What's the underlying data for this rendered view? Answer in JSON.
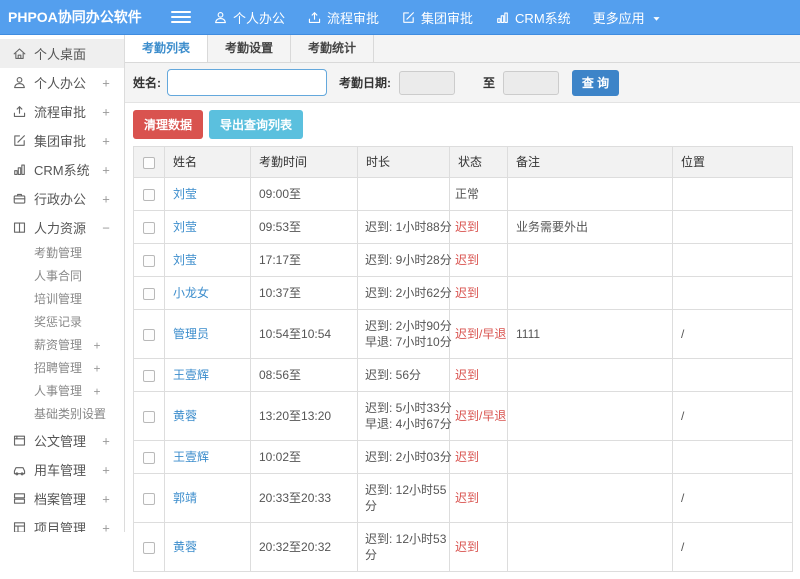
{
  "colors": {
    "header_bg": "#549fee",
    "header_border": "#3f8ce0",
    "accent_blue": "#3c8dcc",
    "button_primary": "#3d84c8",
    "button_danger": "#d9534f",
    "button_info": "#5bc0de",
    "status_alert": "#d9534f"
  },
  "header": {
    "logo": "PHPOA协同办公软件",
    "nav": [
      {
        "label": "个人办公",
        "icon": "user-icon"
      },
      {
        "label": "流程审批",
        "icon": "flow-icon"
      },
      {
        "label": "集团审批",
        "icon": "edit-icon"
      },
      {
        "label": "CRM系统",
        "icon": "chart-icon"
      },
      {
        "label": "更多应用",
        "icon": "caret-down-icon"
      }
    ]
  },
  "sidebar": {
    "items": [
      {
        "label": "个人桌面",
        "icon": "home-icon",
        "expand": "",
        "active": true
      },
      {
        "label": "个人办公",
        "icon": "user-icon",
        "expand": "+"
      },
      {
        "label": "流程审批",
        "icon": "flow-icon",
        "expand": "+"
      },
      {
        "label": "集团审批",
        "icon": "edit-icon",
        "expand": "+"
      },
      {
        "label": "CRM系统",
        "icon": "chart-icon",
        "expand": "+"
      },
      {
        "label": "行政办公",
        "icon": "briefcase-icon",
        "expand": "+"
      },
      {
        "label": "人力资源",
        "icon": "book-icon",
        "expand": "−",
        "children": [
          {
            "label": "考勤管理",
            "expand": ""
          },
          {
            "label": "人事合同",
            "expand": ""
          },
          {
            "label": "培训管理",
            "expand": ""
          },
          {
            "label": "奖惩记录",
            "expand": ""
          },
          {
            "label": "薪资管理",
            "expand": "+"
          },
          {
            "label": "招聘管理",
            "expand": "+"
          },
          {
            "label": "人事管理",
            "expand": "+"
          },
          {
            "label": "基础类别设置",
            "expand": "+"
          }
        ]
      },
      {
        "label": "公文管理",
        "icon": "doc-icon",
        "expand": "+"
      },
      {
        "label": "用车管理",
        "icon": "car-icon",
        "expand": "+"
      },
      {
        "label": "档案管理",
        "icon": "archive-icon",
        "expand": "+"
      },
      {
        "label": "项目管理",
        "icon": "project-icon",
        "expand": "+"
      }
    ]
  },
  "tabs": [
    {
      "label": "考勤列表",
      "active": true
    },
    {
      "label": "考勤设置",
      "active": false
    },
    {
      "label": "考勤统计",
      "active": false
    }
  ],
  "filter": {
    "name_label": "姓名:",
    "name_value": "",
    "date_label": "考勤日期:",
    "date_from": "",
    "to_label": "至",
    "date_to": "",
    "search_button": "查 询"
  },
  "toolbar": {
    "clean_button": "清理数据",
    "export_button": "导出查询列表"
  },
  "table": {
    "columns": [
      "姓名",
      "考勤时间",
      "时长",
      "状态",
      "备注",
      "位置"
    ],
    "rows": [
      {
        "name": "刘莹",
        "time": "09:00至",
        "duration": [],
        "status": "正常",
        "alert": false,
        "remark": "",
        "location": ""
      },
      {
        "name": "刘莹",
        "time": "09:53至",
        "duration": [
          "迟到: 1小时88分"
        ],
        "status": "迟到",
        "alert": true,
        "remark": "业务需要外出",
        "location": ""
      },
      {
        "name": "刘莹",
        "time": "17:17至",
        "duration": [
          "迟到: 9小时28分"
        ],
        "status": "迟到",
        "alert": true,
        "remark": "",
        "location": ""
      },
      {
        "name": "小龙女",
        "time": "10:37至",
        "duration": [
          "迟到: 2小时62分"
        ],
        "status": "迟到",
        "alert": true,
        "remark": "",
        "location": ""
      },
      {
        "name": "管理员",
        "time": "10:54至10:54",
        "duration": [
          "迟到: 2小时90分",
          "早退: 7小时10分"
        ],
        "status": "迟到/早退",
        "alert": true,
        "remark": "1111",
        "location": "/"
      },
      {
        "name": "王壹辉",
        "time": "08:56至",
        "duration": [
          "迟到: 56分"
        ],
        "status": "迟到",
        "alert": true,
        "remark": "",
        "location": ""
      },
      {
        "name": "黄蓉",
        "time": "13:20至13:20",
        "duration": [
          "迟到: 5小时33分",
          "早退: 4小时67分"
        ],
        "status": "迟到/早退",
        "alert": true,
        "remark": "",
        "location": "/"
      },
      {
        "name": "王壹辉",
        "time": "10:02至",
        "duration": [
          "迟到: 2小时03分"
        ],
        "status": "迟到",
        "alert": true,
        "remark": "",
        "location": ""
      },
      {
        "name": "郭靖",
        "time": "20:33至20:33",
        "duration": [
          "迟到: 12小时55分"
        ],
        "status": "迟到",
        "alert": true,
        "remark": "",
        "location": "/"
      },
      {
        "name": "黄蓉",
        "time": "20:32至20:32",
        "duration": [
          "迟到: 12小时53分"
        ],
        "status": "迟到",
        "alert": true,
        "remark": "",
        "location": "/"
      }
    ]
  }
}
